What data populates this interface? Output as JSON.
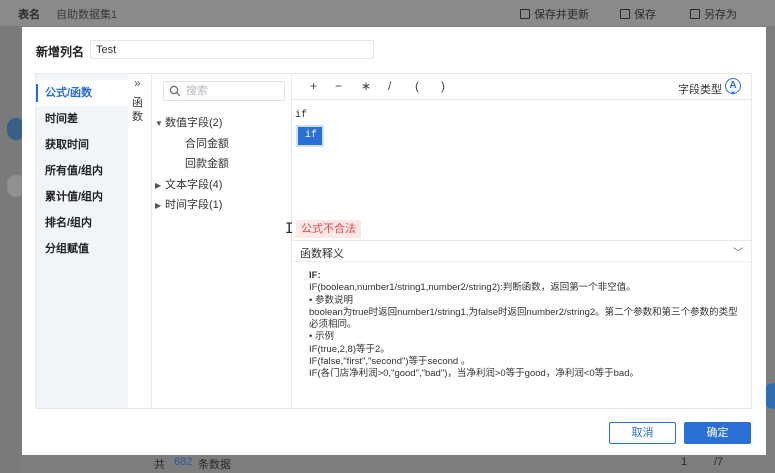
{
  "background": {
    "table_label": "表名",
    "dataset_name": "自助数据集1",
    "actions": [
      "保存并更新",
      "保存",
      "另存为"
    ],
    "footer": {
      "total_prefix": "共",
      "total_count": "682",
      "total_suffix": "条数据",
      "page": "1",
      "pages": "/7"
    }
  },
  "dialog": {
    "title": "新增列名",
    "name_value": "Test",
    "categories": [
      "公式/函数",
      "时间差",
      "获取时间",
      "所有值/组内",
      "累计值/组内",
      "排名/组内",
      "分组赋值"
    ],
    "active_category": 0,
    "function_tab": "函数",
    "search_placeholder": "搜索",
    "tree": {
      "numeric": "数值字段(2)",
      "numeric_children": [
        "合同金额",
        "回款金额"
      ],
      "text": "文本字段(4)",
      "time": "时间字段(1)"
    },
    "operators": [
      "+",
      "−",
      "∗",
      "/",
      "(",
      ")"
    ],
    "field_type_label": "字段类型",
    "field_type_icon": "A",
    "formula": "if",
    "suggestion": "if",
    "error": "公式不合法",
    "description_title": "函数释义",
    "description_lines": [
      "IF:",
      "IF(boolean,number1/string1,number2/string2):判断函数，返回第一个非空值。",
      "• 参数说明",
      "boolean为true时返回number1/string1,为false时返回number2/string2。第二个参数和第三个参数的类型必须相同。",
      "• 示例",
      "IF(true,2,8)等于2。",
      "IF(false,\"first\",\"second\")等于second 。",
      "IF(各门店净利润>0,\"good\",\"bad\")，当净利润>0等于good，净利润<0等于bad。"
    ],
    "cancel_label": "取消",
    "ok_label": "确定"
  }
}
